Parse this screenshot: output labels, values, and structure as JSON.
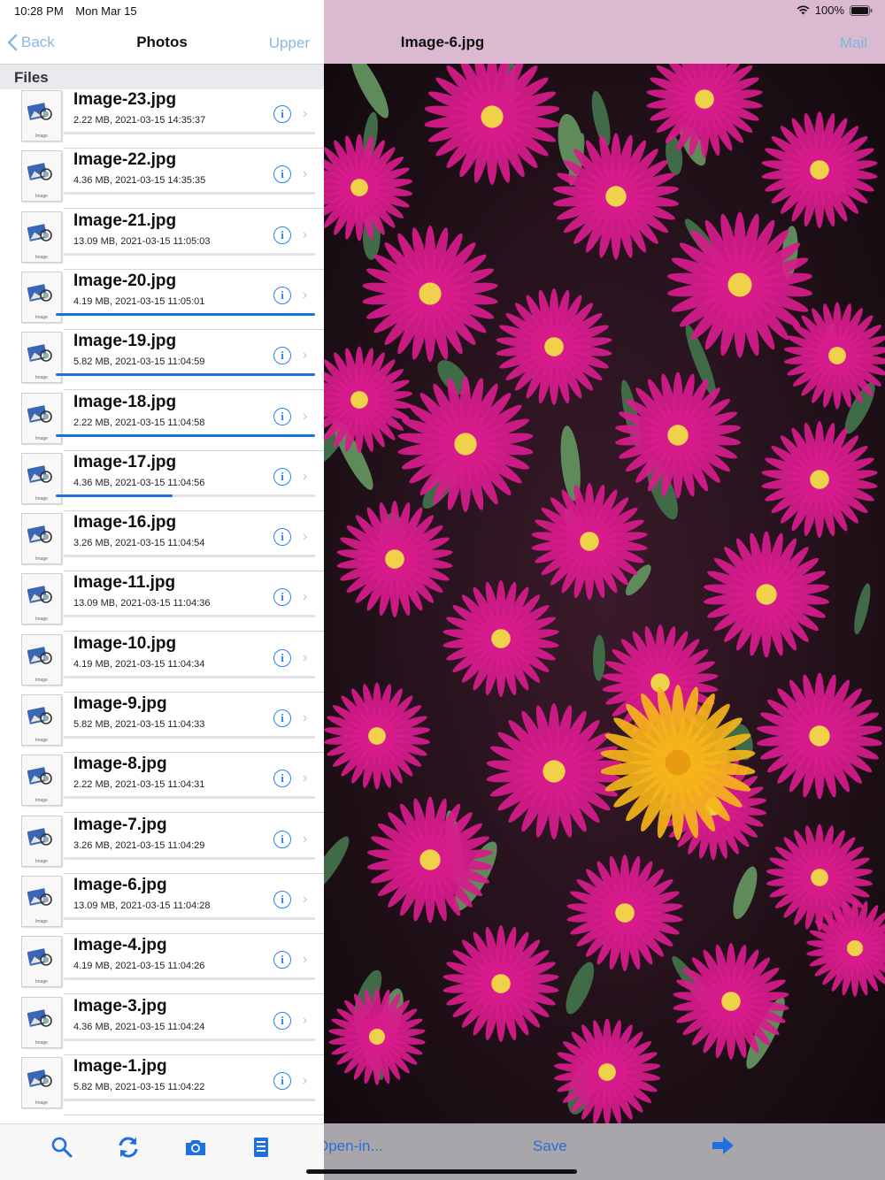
{
  "status": {
    "time": "10:28 PM",
    "date": "Mon Mar 15",
    "battery": "100%"
  },
  "master": {
    "back_label": "Back",
    "title": "Photos",
    "upper_label": "Upper",
    "section": "Files",
    "thumb_caption": "Image",
    "files": [
      {
        "name": "Image-23.jpg",
        "meta": "2.22 MB, 2021-03-15 14:35:37",
        "progress": 0
      },
      {
        "name": "Image-22.jpg",
        "meta": "4.36 MB, 2021-03-15 14:35:35",
        "progress": 0
      },
      {
        "name": "Image-21.jpg",
        "meta": "13.09 MB, 2021-03-15 11:05:03",
        "progress": 0
      },
      {
        "name": "Image-20.jpg",
        "meta": "4.19 MB, 2021-03-15 11:05:01",
        "progress": 1.0
      },
      {
        "name": "Image-19.jpg",
        "meta": "5.82 MB, 2021-03-15 11:04:59",
        "progress": 1.0
      },
      {
        "name": "Image-18.jpg",
        "meta": "2.22 MB, 2021-03-15 11:04:58",
        "progress": 1.0
      },
      {
        "name": "Image-17.jpg",
        "meta": "4.36 MB, 2021-03-15 11:04:56",
        "progress": 0.45
      },
      {
        "name": "Image-16.jpg",
        "meta": "3.26 MB, 2021-03-15 11:04:54",
        "progress": 0
      },
      {
        "name": "Image-11.jpg",
        "meta": "13.09 MB, 2021-03-15 11:04:36",
        "progress": 0
      },
      {
        "name": "Image-10.jpg",
        "meta": "4.19 MB, 2021-03-15 11:04:34",
        "progress": 0
      },
      {
        "name": "Image-9.jpg",
        "meta": "5.82 MB, 2021-03-15 11:04:33",
        "progress": 0
      },
      {
        "name": "Image-8.jpg",
        "meta": "2.22 MB, 2021-03-15 11:04:31",
        "progress": 0
      },
      {
        "name": "Image-7.jpg",
        "meta": "3.26 MB, 2021-03-15 11:04:29",
        "progress": 0
      },
      {
        "name": "Image-6.jpg",
        "meta": "13.09 MB, 2021-03-15 11:04:28",
        "progress": 0
      },
      {
        "name": "Image-4.jpg",
        "meta": "4.19 MB, 2021-03-15 11:04:26",
        "progress": 0
      },
      {
        "name": "Image-3.jpg",
        "meta": "4.36 MB, 2021-03-15 11:04:24",
        "progress": 0
      },
      {
        "name": "Image-1.jpg",
        "meta": "5.82 MB, 2021-03-15 11:04:22",
        "progress": 0
      }
    ],
    "toolbar_icons": [
      "search-icon",
      "refresh-icon",
      "camera-icon",
      "document-icon"
    ]
  },
  "detail": {
    "title": "Image-6.jpg",
    "mail_label": "Mail",
    "open_in_label": "Open-in...",
    "save_label": "Save",
    "forward_icon": "arrow-right-icon"
  },
  "colors": {
    "accent": "#1e6fe0",
    "nav_inactive": "#8ab6e0",
    "flower_magenta": "#d81b8c",
    "flower_yellow": "#f5b41a"
  }
}
